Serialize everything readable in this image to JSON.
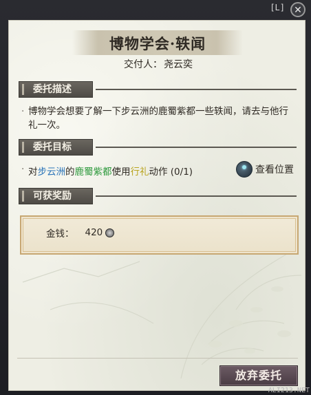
{
  "window": {
    "hotkey": "[L]"
  },
  "quest": {
    "title": "博物学会·轶闻",
    "issuer_label": "交付人：",
    "issuer_name": "尧云奕"
  },
  "sections": {
    "description": "委托描述",
    "objective": "委托目标",
    "rewards": "可获奖励"
  },
  "description_text": "博物学会想要了解一下步云洲的鹿蜀紫都一些轶闻，请去与他行礼一次。",
  "objective": {
    "p1": "对",
    "location": "步云洲",
    "p2": "的",
    "npc": "鹿蜀紫都",
    "p3": "使用",
    "action": "行礼",
    "p4": "动作 (0/1)",
    "locate_label": "查看位置"
  },
  "reward": {
    "label": "金钱：",
    "amount": "420"
  },
  "buttons": {
    "abandon": "放弃委托"
  },
  "watermark": "ALI213.NET",
  "icons": {
    "close": "close-icon",
    "locate": "map-pin-icon",
    "coin": "coin-icon"
  },
  "colors": {
    "location": "#2b74b8",
    "npc": "#2f9a3e",
    "action": "#b9a41f"
  }
}
